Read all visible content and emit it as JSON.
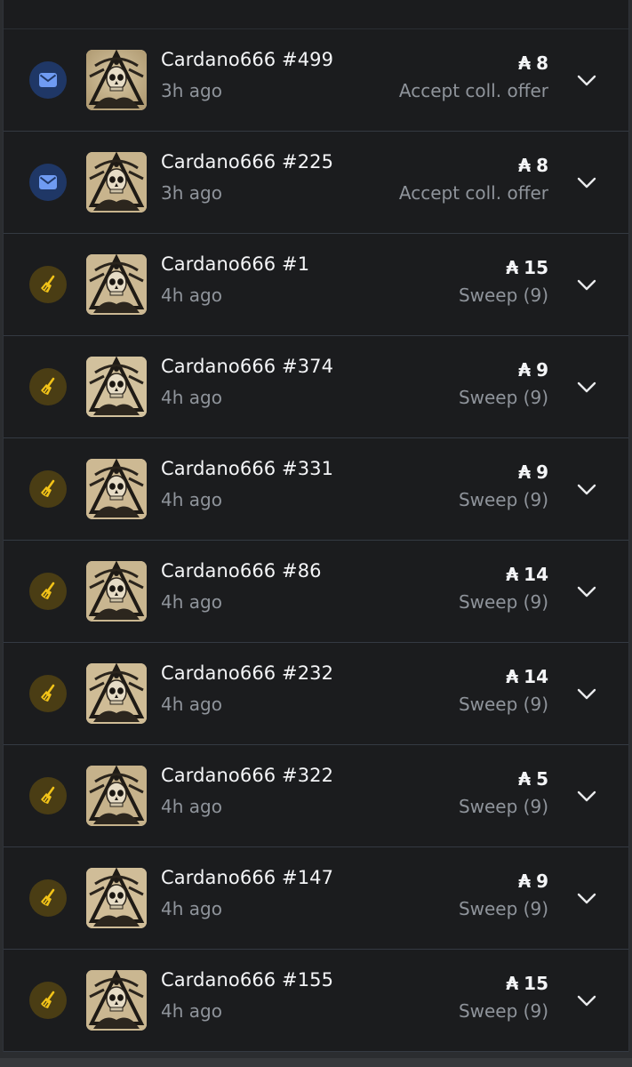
{
  "currency_symbol": "₳",
  "colors": {
    "background": "#1b1c1e",
    "text_primary": "#f4f5f7",
    "text_secondary": "#8f949b",
    "offer_badge_bg": "#1f3766",
    "offer_icon": "#6f9bf2",
    "sweep_badge_bg": "#4a3d14",
    "sweep_icon": "#f2c318"
  },
  "activities": [
    {
      "type_icon": "envelope-icon",
      "name": "Cardano666 #499",
      "time": "3h ago",
      "price": "8",
      "action": "Accept coll. offer"
    },
    {
      "type_icon": "envelope-icon",
      "name": "Cardano666 #225",
      "time": "3h ago",
      "price": "8",
      "action": "Accept coll. offer"
    },
    {
      "type_icon": "broom-icon",
      "name": "Cardano666 #1",
      "time": "4h ago",
      "price": "15",
      "action": "Sweep (9)"
    },
    {
      "type_icon": "broom-icon",
      "name": "Cardano666 #374",
      "time": "4h ago",
      "price": "9",
      "action": "Sweep (9)"
    },
    {
      "type_icon": "broom-icon",
      "name": "Cardano666 #331",
      "time": "4h ago",
      "price": "9",
      "action": "Sweep (9)"
    },
    {
      "type_icon": "broom-icon",
      "name": "Cardano666 #86",
      "time": "4h ago",
      "price": "14",
      "action": "Sweep (9)"
    },
    {
      "type_icon": "broom-icon",
      "name": "Cardano666 #232",
      "time": "4h ago",
      "price": "14",
      "action": "Sweep (9)"
    },
    {
      "type_icon": "broom-icon",
      "name": "Cardano666 #322",
      "time": "4h ago",
      "price": "5",
      "action": "Sweep (9)"
    },
    {
      "type_icon": "broom-icon",
      "name": "Cardano666 #147",
      "time": "4h ago",
      "price": "9",
      "action": "Sweep (9)"
    },
    {
      "type_icon": "broom-icon",
      "name": "Cardano666 #155",
      "time": "4h ago",
      "price": "15",
      "action": "Sweep (9)"
    }
  ]
}
